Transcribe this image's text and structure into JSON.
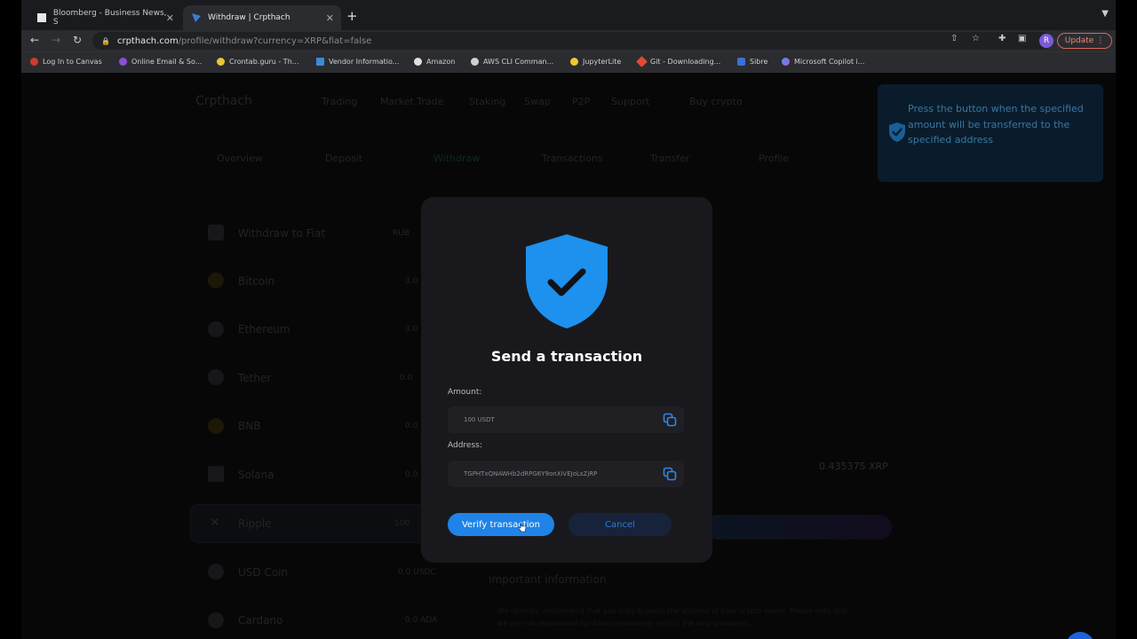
{
  "browser": {
    "tabs": [
      {
        "title": "Bloomberg - Business News, S",
        "active": false
      },
      {
        "title": "Withdraw | Crpthach",
        "active": true
      }
    ],
    "url_host": "crpthach.com",
    "url_path": "/profile/withdraw?currency=XRP&fiat=false",
    "update_label": "Update",
    "profile_initial": "R",
    "bookmarks": [
      "Log In to Canvas",
      "Online Email & So...",
      "Crontab.guru - Th...",
      "Vendor Informatio...",
      "Amazon",
      "AWS CLI Comman...",
      "JupyterLite",
      "Git - Downloading...",
      "Sibre",
      "Microsoft Copilot i..."
    ]
  },
  "background_page": {
    "brand": "Crpthach",
    "nav": [
      "Trading",
      "Market Trade",
      "Staking",
      "Swap",
      "P2P",
      "Support",
      "Buy crypto"
    ],
    "subnav": [
      "Overview",
      "Deposit",
      "Withdraw",
      "Transactions",
      "Transfer",
      "Profile"
    ],
    "currencies": [
      {
        "name": "Withdraw to Fiat",
        "value": "RUB"
      },
      {
        "name": "Bitcoin",
        "value": "0.0"
      },
      {
        "name": "Ethereum",
        "value": "0.0"
      },
      {
        "name": "Tether",
        "value": "0.0"
      },
      {
        "name": "BNB",
        "value": "0.0"
      },
      {
        "name": "Solana",
        "value": "0.0"
      },
      {
        "name": "Ripple",
        "value": "100"
      },
      {
        "name": "USD Coin",
        "value": "0.0 USDC"
      },
      {
        "name": "Cardano",
        "value": "0.0 ADA"
      }
    ],
    "balance": "0.435375 XRP",
    "important_heading": "Important information",
    "important_text_1": "We strongly recommend that you copy & paste the address of your crypto wallet. Please note that",
    "important_text_2": "we are not responsible for funds mistakenly sent to the wrong address."
  },
  "toast": {
    "message": "Press the button when the specified amount will be transferred to the specified address"
  },
  "modal": {
    "title": "Send a transaction",
    "amount_label": "Amount:",
    "amount_value": "100 USDT",
    "address_label": "Address:",
    "address_value": "TGPHTxQNAWHb2dRPG6Y9onXiVEJoLsZjRP",
    "verify_label": "Verify transaction",
    "cancel_label": "Cancel"
  },
  "colors": {
    "accent": "#1f83e8",
    "shield": "#1e90ee",
    "modal_bg": "#19191d",
    "toast_bg": "#0a1c2b"
  }
}
